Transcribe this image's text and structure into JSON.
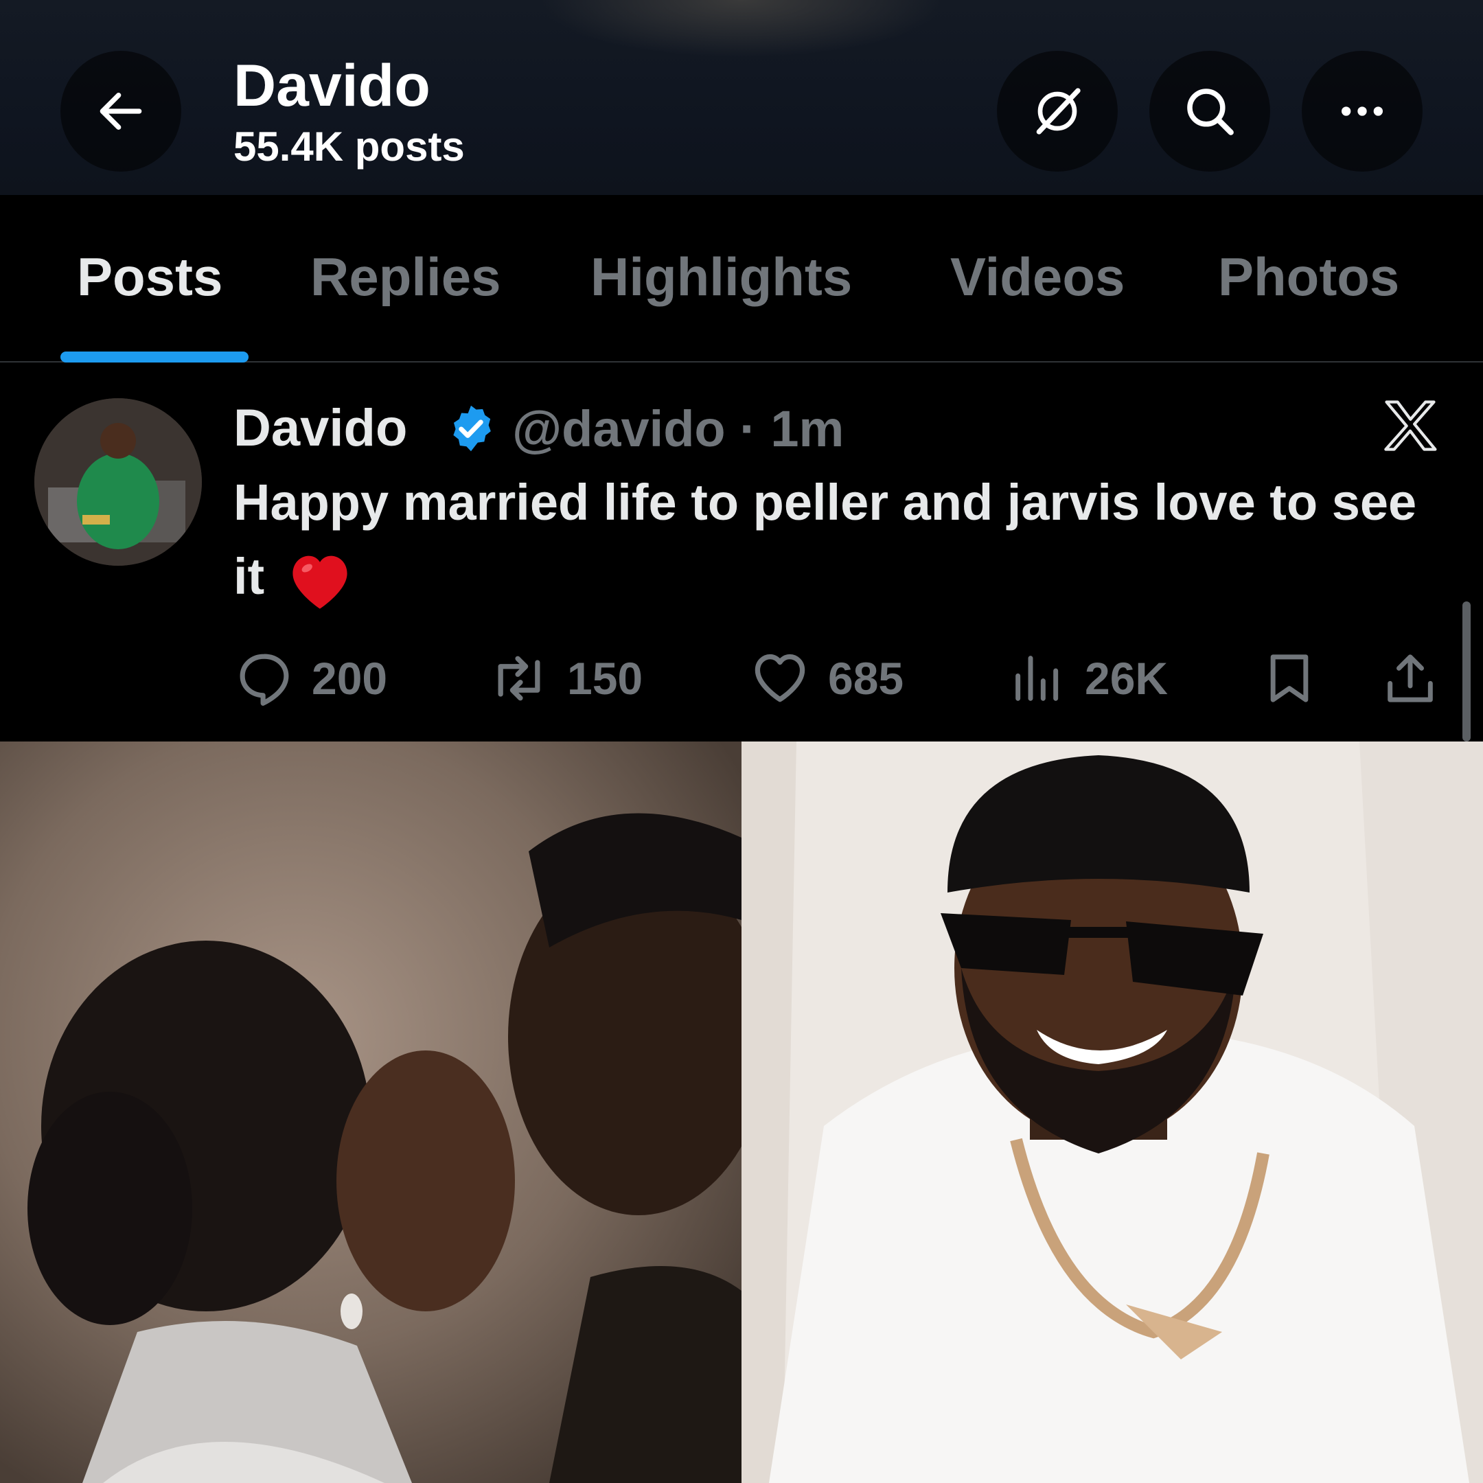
{
  "header": {
    "title": "Davido",
    "subtitle": "55.4K posts",
    "back_icon": "arrow-left-icon",
    "grok_icon": "grok-icon",
    "search_icon": "search-icon",
    "more_icon": "more-horizontal-icon"
  },
  "tabs": [
    {
      "label": "Posts",
      "active": true
    },
    {
      "label": "Replies",
      "active": false
    },
    {
      "label": "Highlights",
      "active": false
    },
    {
      "label": "Videos",
      "active": false
    },
    {
      "label": "Photos",
      "active": false
    }
  ],
  "post": {
    "author": "Davido",
    "handle": "@davido",
    "time": "· 1m",
    "text": "Happy married life to peller and jarvis love to see it",
    "emoji": "red-heart-emoji",
    "verified": true,
    "actions": {
      "replies": "200",
      "reposts": "150",
      "likes": "685",
      "views": "26K"
    }
  },
  "colors": {
    "accent": "#1d9bf0",
    "muted": "#71767b",
    "text": "#e7e9ea",
    "background": "#000000",
    "header_bg": "#111823",
    "heart": "#e0101e"
  },
  "media": [
    {
      "name": "wedding-couple-photo"
    },
    {
      "name": "davido-portrait-photo"
    }
  ]
}
